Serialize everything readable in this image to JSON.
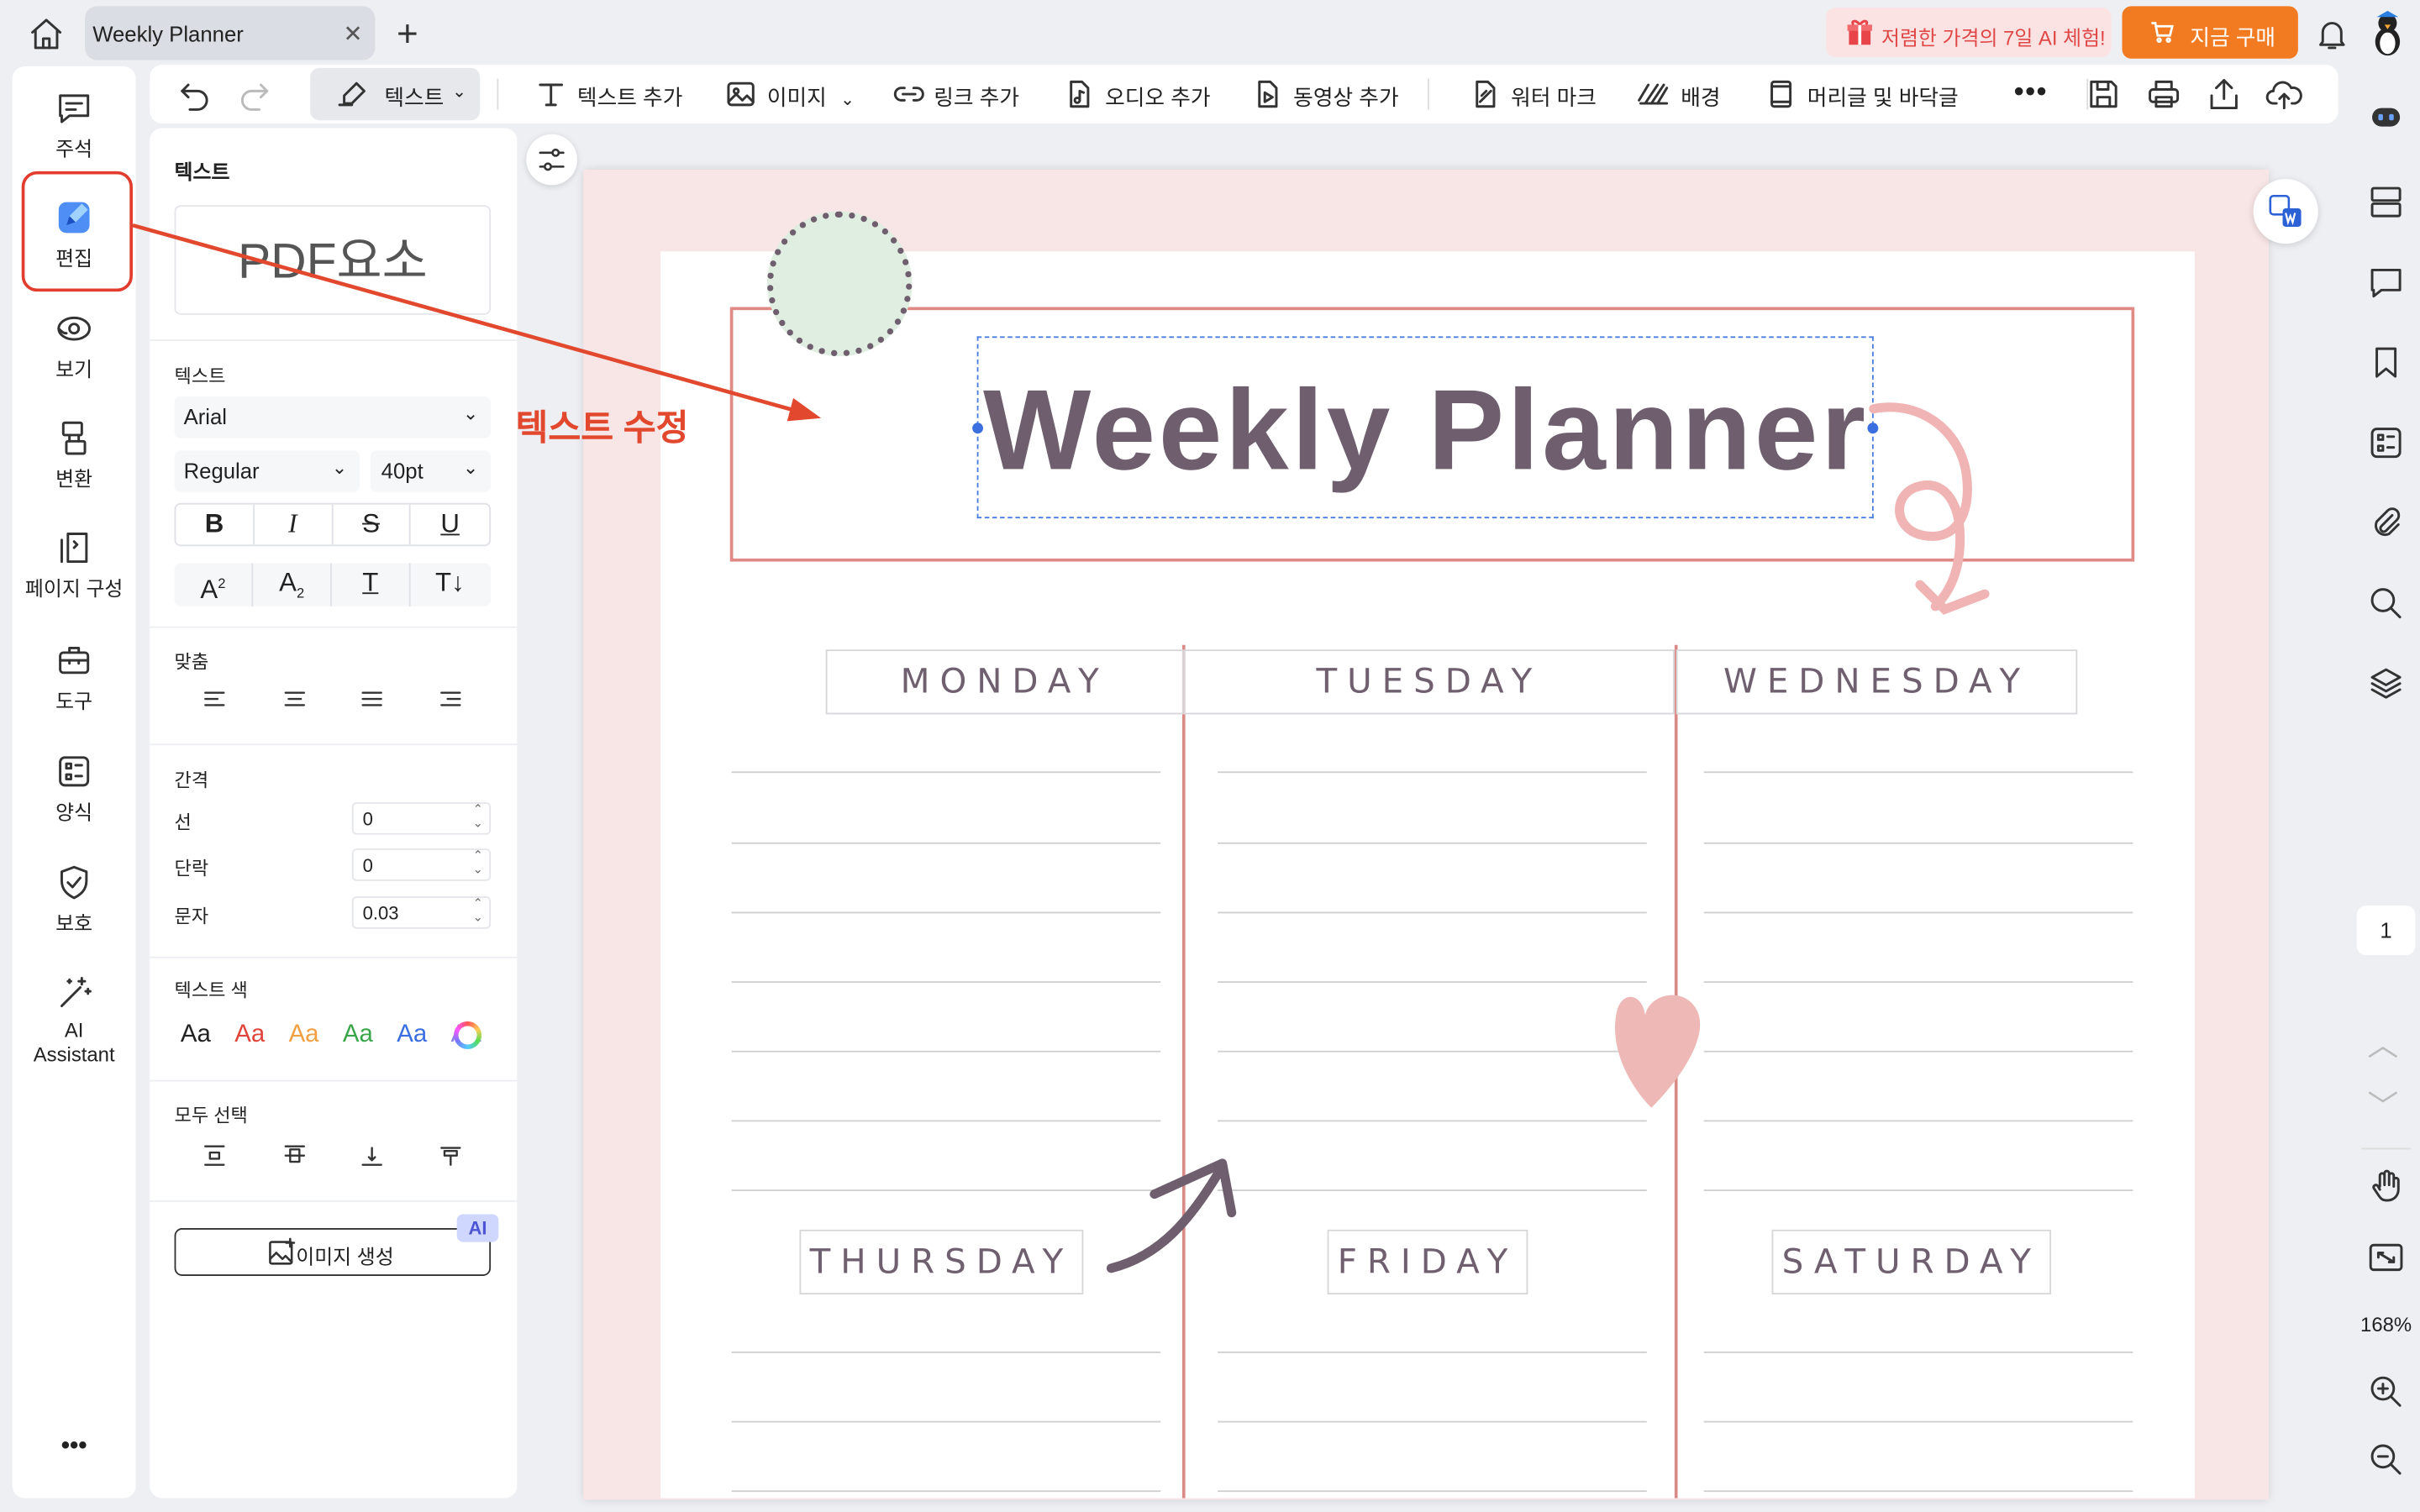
{
  "window": {
    "tab_title": "Weekly Planner",
    "promo_text": "저렴한 가격의 7일 AI 체험!",
    "buy_label": "지금 구매"
  },
  "toolbar": {
    "text_mode": "텍스트",
    "add_text": "텍스트 추가",
    "image": "이미지",
    "add_link": "링크 추가",
    "add_audio": "오디오 추가",
    "add_video": "동영상 추가",
    "watermark": "워터 마크",
    "background": "배경",
    "header_footer": "머리글 및 바닥글"
  },
  "left_nav": {
    "items": [
      {
        "label": "주석",
        "icon": "comment-icon"
      },
      {
        "label": "편집",
        "icon": "edit-icon"
      },
      {
        "label": "보기",
        "icon": "eye-icon"
      },
      {
        "label": "변환",
        "icon": "convert-icon"
      },
      {
        "label": "페이지 구성",
        "icon": "page-organize-icon"
      },
      {
        "label": "도구",
        "icon": "toolbox-icon"
      },
      {
        "label": "양식",
        "icon": "form-icon"
      },
      {
        "label": "보호",
        "icon": "shield-icon"
      },
      {
        "label": "AI Assistant",
        "icon": "ai-wand-icon"
      }
    ]
  },
  "panel": {
    "title": "텍스트",
    "preview": "PDF요소",
    "text_section": "텍스트",
    "font": "Arial",
    "style": "Regular",
    "size": "40pt",
    "align_section": "맞춤",
    "spacing_section": "간격",
    "line_label": "선",
    "line_value": "0",
    "paragraph_label": "단락",
    "paragraph_value": "0",
    "char_label": "문자",
    "char_value": "0.03",
    "color_section": "텍스트 색",
    "color_sample": "Aa",
    "colors": [
      "#222222",
      "#e0443a",
      "#f0a040",
      "#3aa54a",
      "#3a6ee0",
      "#8a7ee0"
    ],
    "select_all_section": "모두 선택",
    "ai_badge": "AI",
    "generate_image": "이미지 생성"
  },
  "annotation": {
    "label": "텍스트 수정",
    "color": "#e2482e"
  },
  "document": {
    "title": "Weekly Planner",
    "days": [
      "MONDAY",
      "TUESDAY",
      "WEDNESDAY",
      "THURSDAY",
      "FRIDAY",
      "SATURDAY"
    ]
  },
  "right_sidebar": {
    "page_number": "1",
    "zoom": "168%"
  }
}
